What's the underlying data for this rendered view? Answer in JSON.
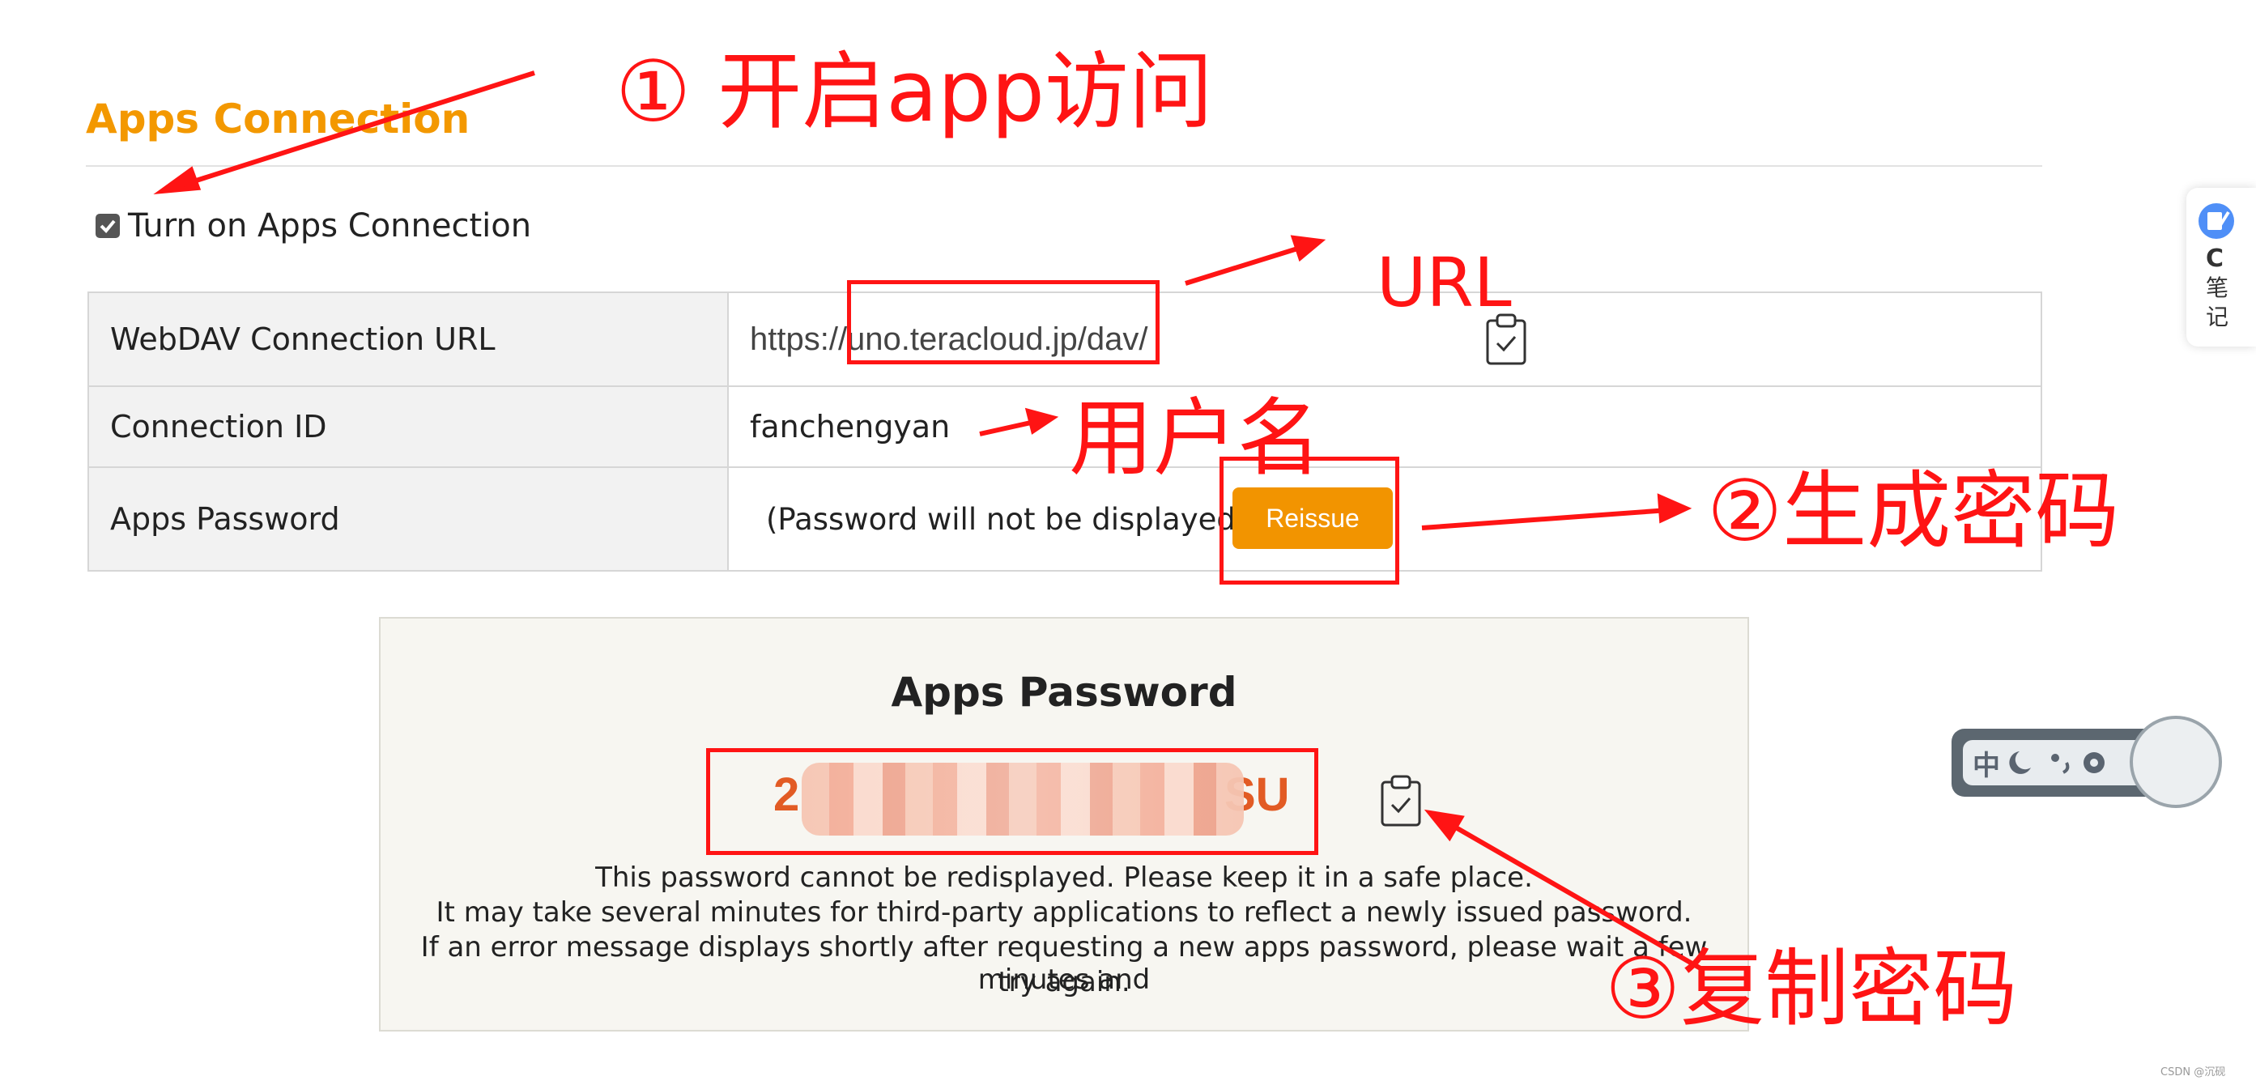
{
  "section": {
    "title": "Apps Connection",
    "toggle_label": "Turn on Apps Connection",
    "toggle_checked": true
  },
  "table": {
    "rows": [
      {
        "label": "WebDAV Connection URL",
        "value": "https://uno.teracloud.jp/dav/"
      },
      {
        "label": "Connection ID",
        "value": "fanchengyan"
      },
      {
        "label": "Apps Password",
        "value": "(Password will not be displayed)"
      }
    ],
    "reissue_label": "Reissue"
  },
  "panel": {
    "title": "Apps Password",
    "password_start": "2",
    "password_end": "SU",
    "notes": [
      "This password cannot be redisplayed. Please keep it in a safe place.",
      "It may take several minutes for third-party applications to reflect a newly issued password.",
      "If an error message displays shortly after requesting a new apps password, please wait a few minutes and",
      "try again."
    ]
  },
  "annotations": {
    "step1": "① 开启app访问",
    "url": "URL",
    "username": "用户名",
    "step2": "②生成密码",
    "step3": "③复制密码"
  },
  "side_widgets": {
    "note_letter": "C",
    "note_text": "笔记",
    "ime_label": "中",
    "watermark": "CSDN @沉砚"
  },
  "colors": {
    "accent": "#f39800",
    "button": "#f29400",
    "annotation": "#ff1414",
    "password": "#e25b24"
  },
  "icons": [
    "checkbox-icon",
    "clipboard-icon",
    "note-icon",
    "moon-icon",
    "gear-icon"
  ]
}
